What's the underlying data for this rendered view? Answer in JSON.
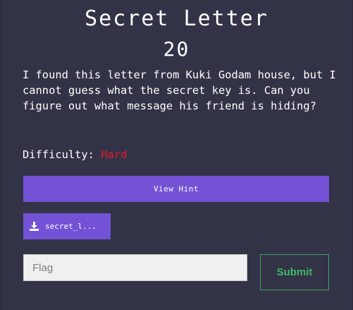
{
  "challenge": {
    "title": "Secret Letter",
    "points": "20",
    "description": "I found this letter from Kuki Godam house, but I cannot guess what the secret key is. Can you figure out what message his friend is hiding?",
    "difficulty_label": "Difficulty:",
    "difficulty_value": "Hard"
  },
  "actions": {
    "hint_label": "View Hint",
    "file_label": "secret_l...",
    "file_icon": "download-icon"
  },
  "flag_form": {
    "placeholder": "Flag",
    "value": "",
    "submit_label": "Submit"
  },
  "colors": {
    "background": "#333348",
    "accent": "#7352d6",
    "difficulty_hard": "#e8182a",
    "submit": "#3fb866"
  }
}
